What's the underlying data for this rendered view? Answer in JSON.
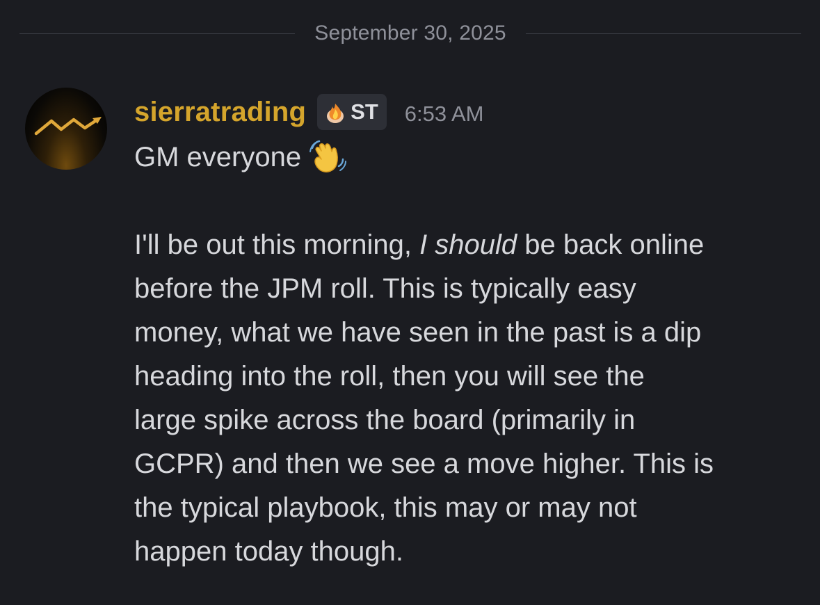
{
  "divider": {
    "date": "September 30, 2025"
  },
  "message": {
    "username": "sierratrading",
    "tag": {
      "icon": "flame-icon",
      "text": "ST"
    },
    "timestamp": "6:53 AM",
    "colors": {
      "username": "#d5a52c",
      "background": "#1b1c21",
      "text": "#d7d8dc",
      "muted": "#8f919a"
    },
    "greeting": {
      "text": "GM everyone",
      "emoji": "waving-hand-icon"
    },
    "body_lines": [
      {
        "pre": "I'll be out this morning, ",
        "em": "I should",
        "post": " be back online"
      },
      {
        "text": "before the JPM roll. This is typically easy"
      },
      {
        "text": "money, what we have seen in the past is a dip"
      },
      {
        "text": "heading into the roll, then you will see the"
      },
      {
        "text": "large spike across the board (primarily in"
      },
      {
        "text": "GCPR) and then we see a move higher. This is"
      },
      {
        "text": "the typical playbook, this may or may not"
      },
      {
        "text": "happen today though."
      }
    ]
  }
}
